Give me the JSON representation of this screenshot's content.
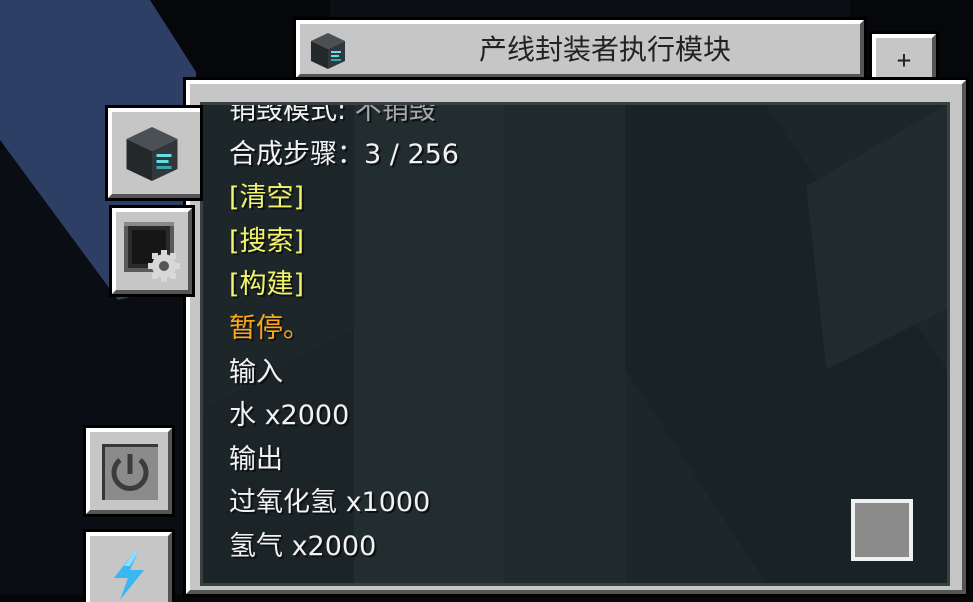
{
  "window": {
    "title": "产线封装者执行模块",
    "plus_label": "+"
  },
  "tabs": [
    {
      "name": "machine",
      "icon": "pattern-provider-cube-icon"
    },
    {
      "name": "config",
      "icon": "gear-config-icon"
    },
    {
      "name": "power",
      "icon": "power-icon"
    },
    {
      "name": "energy",
      "icon": "lightning-icon"
    }
  ],
  "info": {
    "destroy_mode_label": "销毁模式:",
    "destroy_mode_value": "不销毁",
    "craft_steps": "合成步骤：3 / 256",
    "clear_button": "[清空]",
    "search_button": "[搜索]",
    "build_button": "[构建]",
    "status": "暂停。",
    "input_header": "输入",
    "input_items": [
      "水 x2000"
    ],
    "output_header": "输出",
    "output_items": [
      "过氧化氢 x1000",
      "氢气 x2000"
    ]
  },
  "colors": {
    "panel": "#c6c6c6",
    "screen": "#1e282b",
    "text": "#f2f2f2",
    "muted": "#a8a8a8",
    "link": "#f3f36a",
    "status": "#ffa51c",
    "energy": "#3ab6f0"
  }
}
